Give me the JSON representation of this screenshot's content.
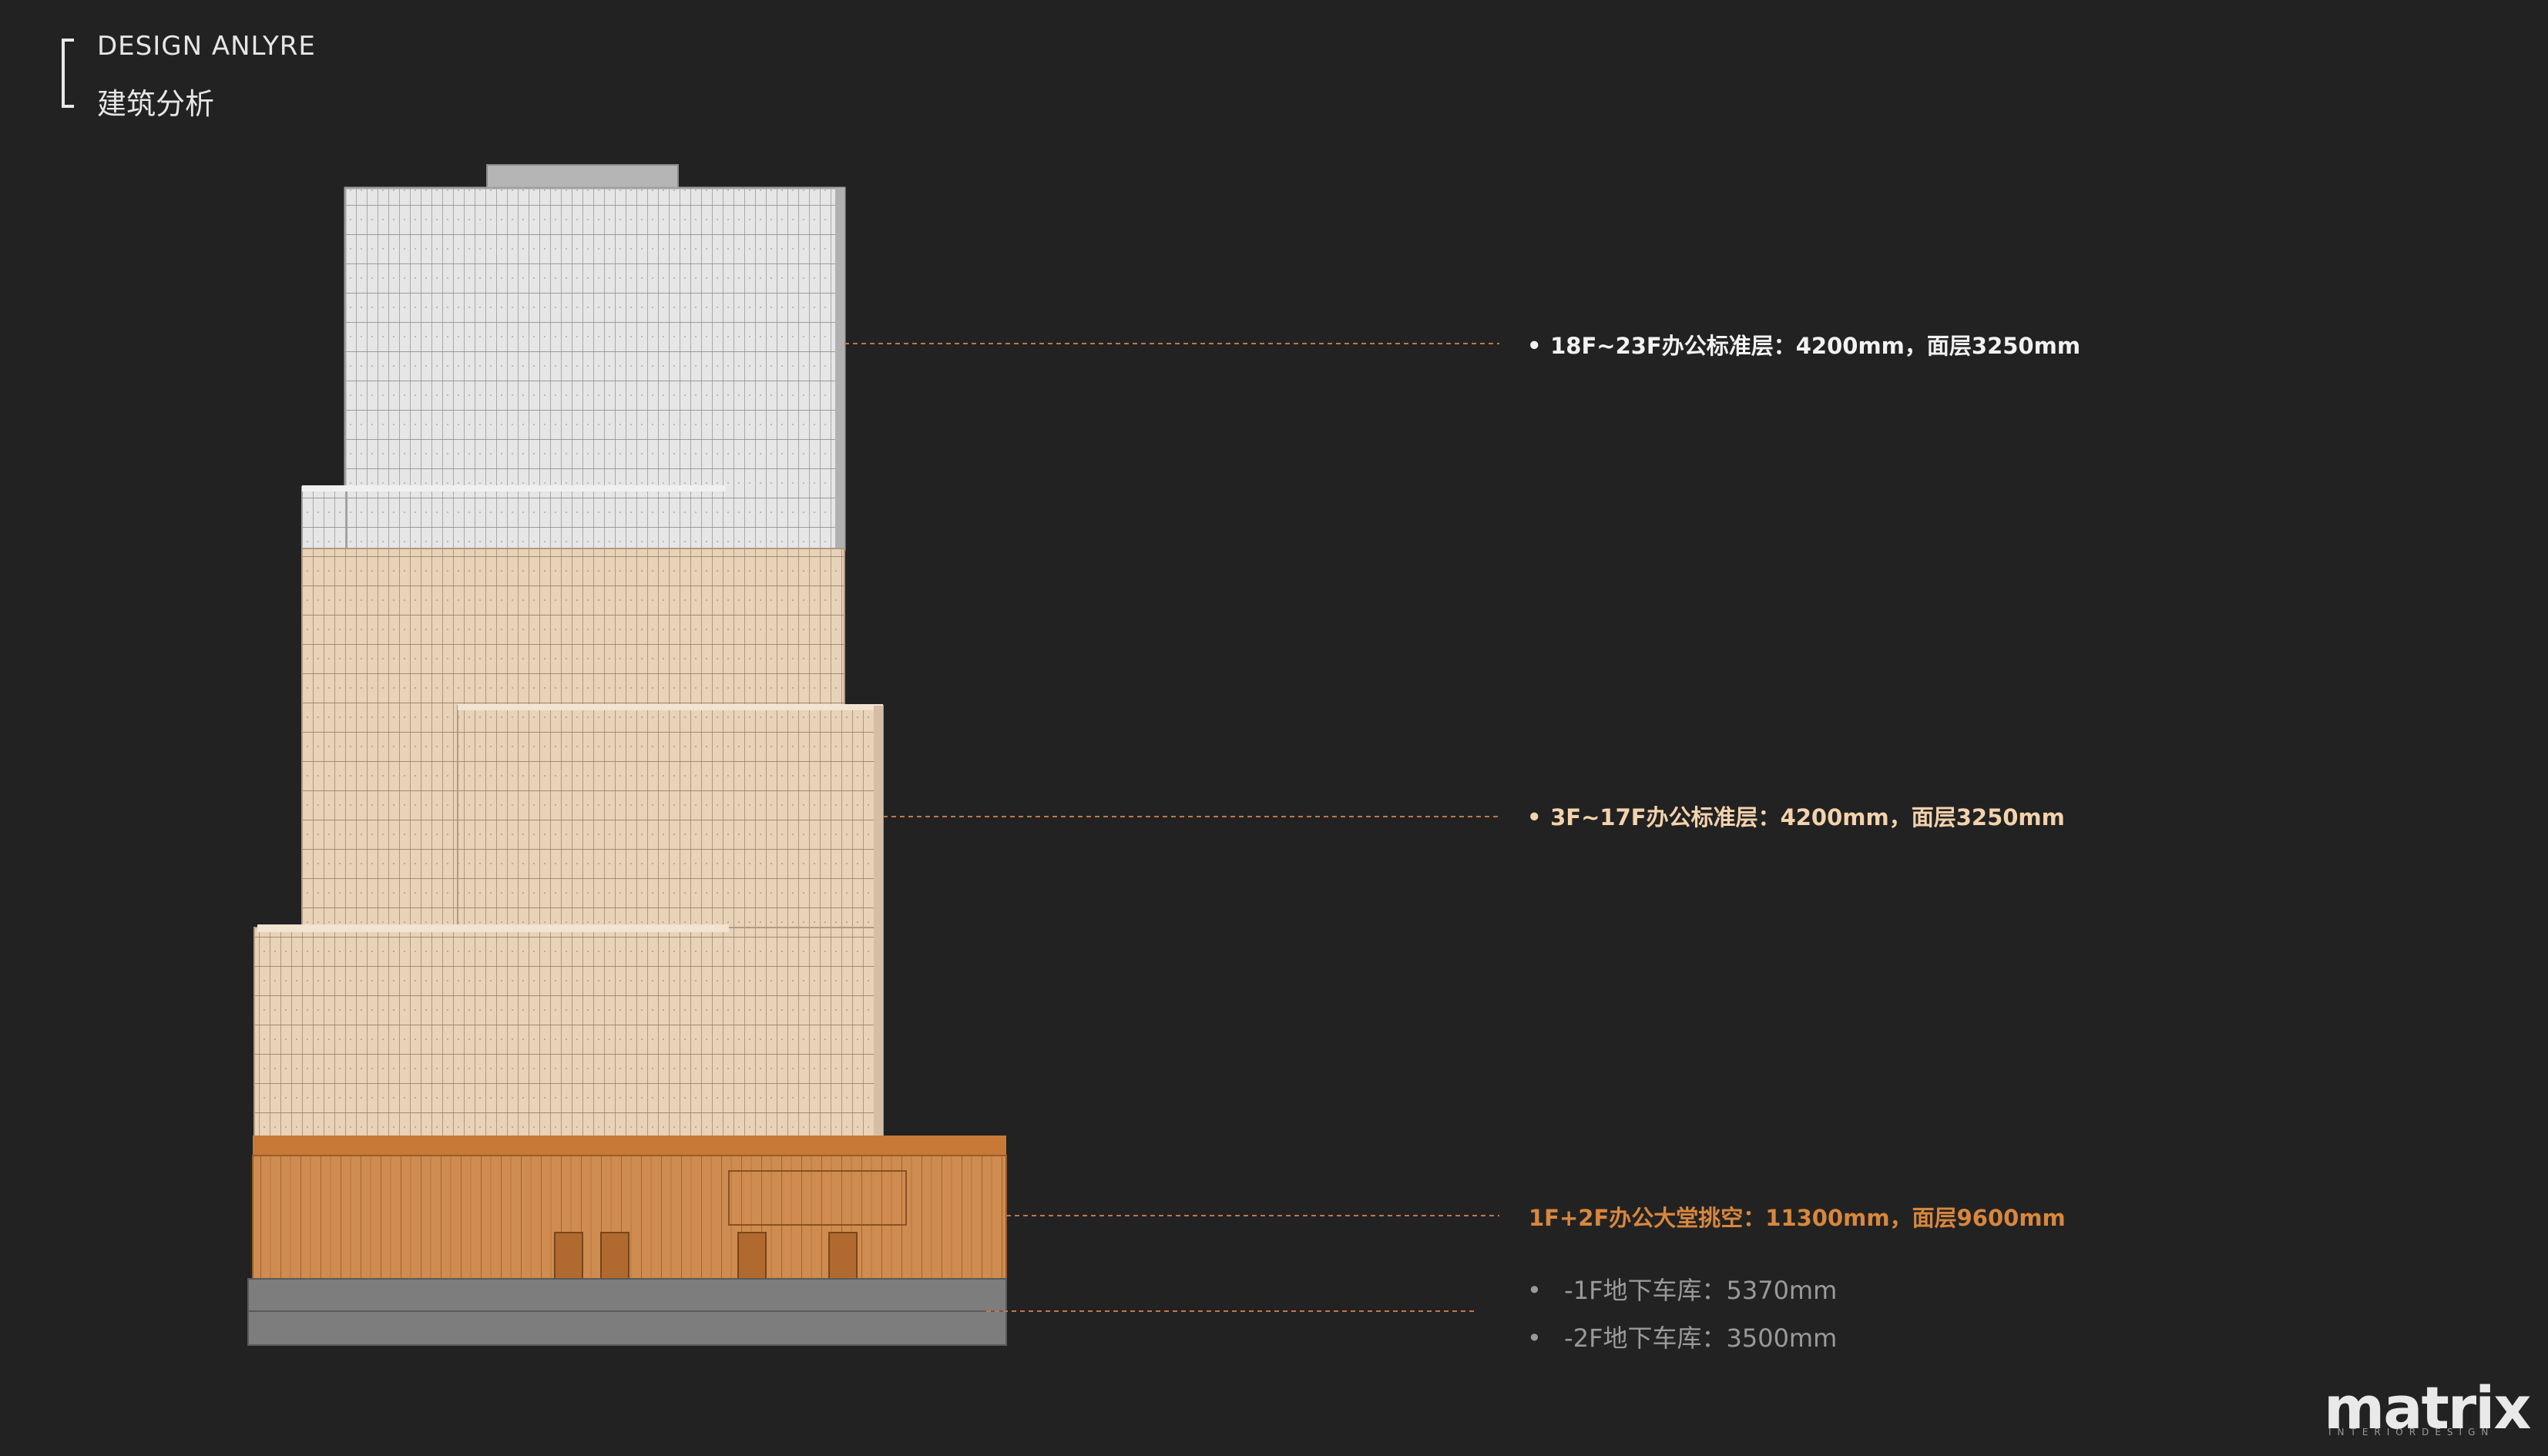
{
  "header": {
    "title_en": "DESIGN ANLYRE",
    "title_cn": "建筑分析"
  },
  "annotations": [
    {
      "id": "upper-floors",
      "label": "18F~23F办公标准层：4200mm，面层3250mm",
      "color": "#f2f2f2"
    },
    {
      "id": "mid-floors",
      "label": "3F~17F办公标准层：4200mm，面层3250mm",
      "color": "#f3d2ad"
    },
    {
      "id": "lobby",
      "label": "1F+2F办公大堂挑空：11300mm，面层9600mm",
      "color": "#d8873e"
    },
    {
      "id": "basement-1",
      "label": "-1F地下车库：5370mm",
      "color": "#9a9a9a"
    },
    {
      "id": "basement-2",
      "label": "-2F地下车库：3500mm",
      "color": "#9a9a9a"
    }
  ],
  "bullet": "•",
  "colors": {
    "background": "#222222",
    "upper_facade": "#e4e4e4",
    "mid_facade": "#e6cfb4",
    "lobby_facade": "#cf8c50",
    "basement": "#7d7d7d",
    "leader_line": "#c0784a"
  },
  "logo": {
    "name": "matrix",
    "tagline": "INTERIORDESIGN"
  }
}
